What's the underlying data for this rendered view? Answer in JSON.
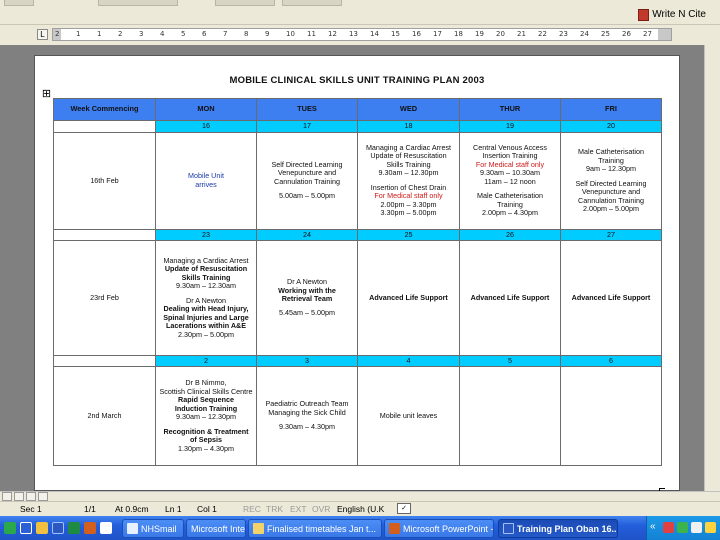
{
  "toolbar": {
    "endnote_label": "Write N Cite"
  },
  "ruler": {
    "ticks": [
      "2",
      "1",
      "1",
      "2",
      "3",
      "4",
      "5",
      "6",
      "7",
      "8",
      "9",
      "10",
      "11",
      "12",
      "13",
      "14",
      "15",
      "16",
      "17",
      "18",
      "19",
      "20",
      "21",
      "22",
      "23",
      "24",
      "25",
      "26",
      "27"
    ]
  },
  "document": {
    "title": "MOBILE CLINICAL SKILLS UNIT TRAINING PLAN 2003",
    "header": {
      "week": "Week Commencing",
      "mon": "MON",
      "tues": "TUES",
      "wed": "WED",
      "thur": "THUR",
      "fri": "FRI"
    },
    "weeks": [
      {
        "label": "16th Feb",
        "dates": [
          "16",
          "17",
          "18",
          "19",
          "20"
        ],
        "mon": {
          "line1": "Mobile Unit",
          "line2": "arrives"
        },
        "tue": {
          "l1": "Self Directed Learning",
          "l2": "Venepuncture and",
          "l3": "Cannulation Training",
          "l4": "5.00am – 5.00pm"
        },
        "wed": {
          "l1": "Managing a Cardiac Arrest",
          "l2": "Update of Resuscitation",
          "l3": "Skills Training",
          "l4": "9.30am – 12.30pm",
          "l5": "Insertion of Chest Drain",
          "l6": "For Medical staff only",
          "l7": "2.00pm – 3.30pm",
          "l8": "3.30pm – 5.00pm"
        },
        "thu": {
          "l1": "Central Venous Access",
          "l2": "Insertion Training",
          "l3": "For Medical staff only",
          "l4": "9.30am – 10.30am",
          "l5": "11am – 12 noon",
          "l6": "Male Catheterisation",
          "l7": "Training",
          "l8": "2.00pm – 4.30pm"
        },
        "fri": {
          "l1": "Male Catheterisation",
          "l2": "Training",
          "l3": "9am – 12.30pm",
          "l4": "Self Directed Learning",
          "l5": "Venepuncture and",
          "l6": "Cannulation Training",
          "l7": "2.00pm – 5.00pm"
        }
      },
      {
        "label": "23rd Feb",
        "dates": [
          "23",
          "24",
          "25",
          "26",
          "27"
        ],
        "mon": {
          "l1": "Managing a Cardiac Arrest",
          "l2": "Update of Resuscitation",
          "l3": "Skills Training",
          "l4": "9.30am – 12.30am",
          "l5": "Dr A Newton",
          "l6": "Dealing with Head Injury,",
          "l7": "Spinal Injuries and Large",
          "l8": "Lacerations within A&E",
          "l9": "2.30pm – 5.00pm"
        },
        "tue": {
          "l1": "Dr A Newton",
          "l2": "Working with the",
          "l3": "Retrieval Team",
          "l4": "5.45am – 5.00pm"
        },
        "wed": "Advanced Life Support",
        "thu": "Advanced Life Support",
        "fri": "Advanced Life Support"
      },
      {
        "label": "2nd March",
        "dates": [
          "2",
          "3",
          "4",
          "5",
          "6"
        ],
        "mon": {
          "l1": "Dr B Nimmo,",
          "l2": "Scottish Clinical Skills Centre",
          "l3": "Rapid Sequence",
          "l4": "Induction Training",
          "l5": "9.30am – 12.30pm",
          "l6": "Recognition & Treatment",
          "l7": "of Sepsis",
          "l8": "1.30pm – 4.30pm"
        },
        "tue": {
          "l1": "Paediatric Outreach Team",
          "l2": "Managing the Sick Child",
          "l3": "9.30am – 4.30pm"
        },
        "wed": "Mobile unit leaves",
        "thu": "",
        "fri": ""
      }
    ]
  },
  "statusbar": {
    "section": "Sec 1",
    "page": "1/1",
    "at": "At 0.9cm",
    "line": "Ln 1",
    "col": "Col 1",
    "rec": "REC",
    "trk": "TRK",
    "ext": "EXT",
    "ovr": "OVR",
    "language": "English (U.K"
  },
  "taskbar": {
    "tasks": [
      "NHSmail",
      "Microsoft Inter...",
      "Finalised timetables Jan t...",
      "Microsoft PowerPoint - [...",
      "Training Plan Oban 16..."
    ]
  },
  "colors": {
    "header_blue": "#3d7ef0",
    "date_cyan": "#00ccff",
    "red_note": "#cc1a1a",
    "taskbar_blue": "#245edb"
  }
}
